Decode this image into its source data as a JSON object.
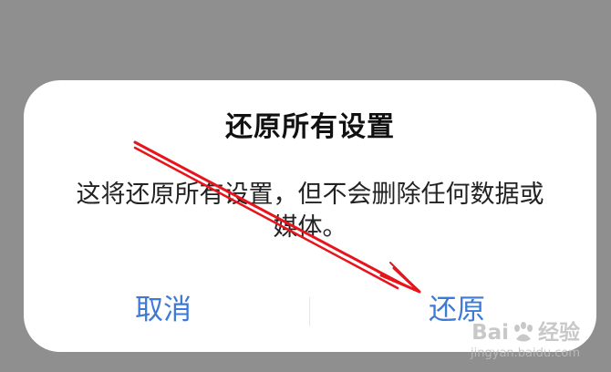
{
  "dialog": {
    "title": "还原所有设置",
    "message": "这将还原所有设置，但不会删除任何数据或媒体。",
    "cancel_label": "取消",
    "confirm_label": "还原"
  },
  "watermark": {
    "logo_left": "Bai",
    "logo_right": "经验",
    "url": "jingyan.baidu.com"
  },
  "colors": {
    "backdrop": "#8f8f8f",
    "dialog_bg": "#ffffff",
    "accent": "#3d7ad6",
    "annotation": "#e8141c"
  },
  "icons": {
    "annotation": "red-arrow-icon",
    "watermark": "baidu-paw-icon"
  }
}
